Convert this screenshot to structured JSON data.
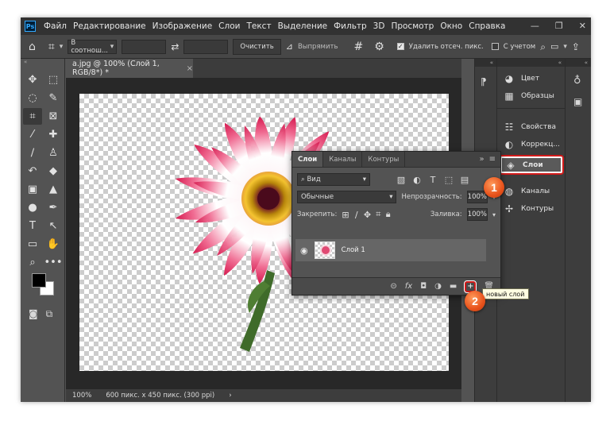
{
  "menubar": {
    "logo": "Ps",
    "items": [
      "Файл",
      "Редактирование",
      "Изображение",
      "Слои",
      "Текст",
      "Выделение",
      "Фильтр",
      "3D",
      "Просмотр",
      "Окно",
      "Справка"
    ],
    "window_controls": [
      "—",
      "❐",
      "✕"
    ]
  },
  "options": {
    "ratio_select": "В соотнош...",
    "clear_label": "Очистить",
    "straighten_label": "Выпрямить",
    "delete_cropped_label": "Удалить отсеч. пикс.",
    "content_aware_label": "С учетом",
    "delete_cropped_checked": true
  },
  "document": {
    "tab_title": "a.jpg @ 100% (Слой 1, RGB/8*) *",
    "tab_close": "×",
    "status_zoom": "100%",
    "status_info": "600 пикс. x 450 пикс. (300 ppi)",
    "status_arrow": "›"
  },
  "right_panels": {
    "group1": [
      {
        "icon": "color-icon",
        "label": "Цвет"
      },
      {
        "icon": "swatches-icon",
        "label": "Образцы"
      }
    ],
    "group2": [
      {
        "icon": "properties-icon",
        "label": "Свойства"
      },
      {
        "icon": "adjustments-icon",
        "label": "Коррекц..."
      }
    ],
    "group3": [
      {
        "icon": "layers-icon",
        "label": "Слои"
      },
      {
        "icon": "channels-icon",
        "label": "Каналы"
      },
      {
        "icon": "paths-icon",
        "label": "Контуры"
      }
    ]
  },
  "layers_panel": {
    "tabs": [
      "Слои",
      "Каналы",
      "Контуры"
    ],
    "active_tab": "Слои",
    "search_kind": "Вид",
    "blend_mode": "Обычные",
    "opacity_label": "Непрозрачность:",
    "opacity_value": "100%",
    "lock_label": "Закрепить:",
    "fill_label": "Заливка:",
    "fill_value": "100%",
    "layer_name": "Слой 1"
  },
  "tooltip": {
    "text": "новый слой"
  },
  "badges": {
    "first": "1",
    "second": "2"
  },
  "colors": {
    "highlight": "#d21a1a",
    "badge": "#e8521b",
    "ui_bg": "#535353",
    "menubar_bg": "#323232"
  }
}
